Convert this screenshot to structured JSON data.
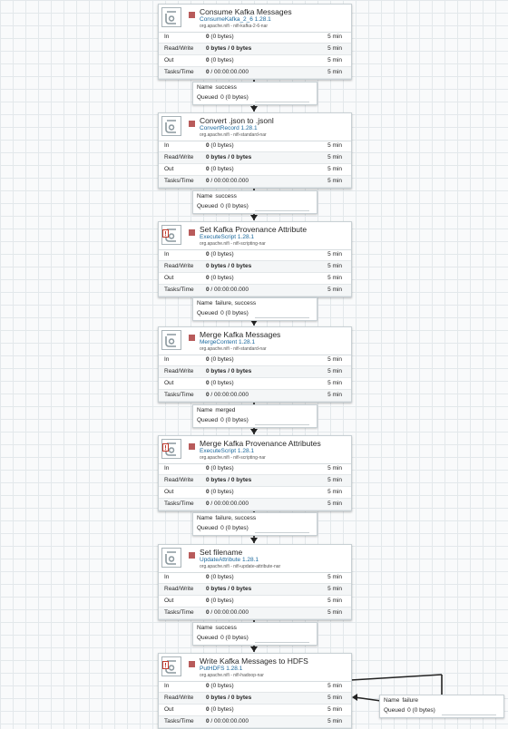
{
  "processors": [
    {
      "name": "Consume Kafka Messages",
      "type": "ConsumeKafka_2_6 1.28.1",
      "bundle": "org.apache.nifi - nifi-kafka-2-6-nar",
      "has_badge": false,
      "stats": [
        {
          "label": "In",
          "value": "0 (0 bytes)",
          "window": "5 min"
        },
        {
          "label": "Read/Write",
          "value": "0 bytes / 0 bytes",
          "window": "5 min"
        },
        {
          "label": "Out",
          "value": "0 (0 bytes)",
          "window": "5 min"
        },
        {
          "label": "Tasks/Time",
          "value": "0 / 00:00:00.000",
          "window": "5 min"
        }
      ]
    },
    {
      "name": "Convert .json to .jsonl",
      "type": "ConvertRecord 1.28.1",
      "bundle": "org.apache.nifi - nifi-standard-nar",
      "has_badge": false,
      "stats": [
        {
          "label": "In",
          "value": "0 (0 bytes)",
          "window": "5 min"
        },
        {
          "label": "Read/Write",
          "value": "0 bytes / 0 bytes",
          "window": "5 min"
        },
        {
          "label": "Out",
          "value": "0 (0 bytes)",
          "window": "5 min"
        },
        {
          "label": "Tasks/Time",
          "value": "0 / 00:00:00.000",
          "window": "5 min"
        }
      ]
    },
    {
      "name": "Set Kafka Provenance Attribute",
      "type": "ExecuteScript 1.28.1",
      "bundle": "org.apache.nifi - nifi-scripting-nar",
      "has_badge": true,
      "stats": [
        {
          "label": "In",
          "value": "0 (0 bytes)",
          "window": "5 min"
        },
        {
          "label": "Read/Write",
          "value": "0 bytes / 0 bytes",
          "window": "5 min"
        },
        {
          "label": "Out",
          "value": "0 (0 bytes)",
          "window": "5 min"
        },
        {
          "label": "Tasks/Time",
          "value": "0 / 00:00:00.000",
          "window": "5 min"
        }
      ]
    },
    {
      "name": "Merge Kafka Messages",
      "type": "MergeContent 1.28.1",
      "bundle": "org.apache.nifi - nifi-standard-nar",
      "has_badge": false,
      "stats": [
        {
          "label": "In",
          "value": "0 (0 bytes)",
          "window": "5 min"
        },
        {
          "label": "Read/Write",
          "value": "0 bytes / 0 bytes",
          "window": "5 min"
        },
        {
          "label": "Out",
          "value": "0 (0 bytes)",
          "window": "5 min"
        },
        {
          "label": "Tasks/Time",
          "value": "0 / 00:00:00.000",
          "window": "5 min"
        }
      ]
    },
    {
      "name": "Merge Kafka Provenance Attributes",
      "type": "ExecuteScript 1.28.1",
      "bundle": "org.apache.nifi - nifi-scripting-nar",
      "has_badge": true,
      "stats": [
        {
          "label": "In",
          "value": "0 (0 bytes)",
          "window": "5 min"
        },
        {
          "label": "Read/Write",
          "value": "0 bytes / 0 bytes",
          "window": "5 min"
        },
        {
          "label": "Out",
          "value": "0 (0 bytes)",
          "window": "5 min"
        },
        {
          "label": "Tasks/Time",
          "value": "0 / 00:00:00.000",
          "window": "5 min"
        }
      ]
    },
    {
      "name": "Set filename",
      "type": "UpdateAttribute 1.28.1",
      "bundle": "org.apache.nifi - nifi-update-attribute-nar",
      "has_badge": false,
      "stats": [
        {
          "label": "In",
          "value": "0 (0 bytes)",
          "window": "5 min"
        },
        {
          "label": "Read/Write",
          "value": "0 bytes / 0 bytes",
          "window": "5 min"
        },
        {
          "label": "Out",
          "value": "0 (0 bytes)",
          "window": "5 min"
        },
        {
          "label": "Tasks/Time",
          "value": "0 / 00:00:00.000",
          "window": "5 min"
        }
      ]
    },
    {
      "name": "Write Kafka Messages to HDFS",
      "type": "PutHDFS 1.28.1",
      "bundle": "org.apache.nifi - nifi-hadoop-nar",
      "has_badge": true,
      "stats": [
        {
          "label": "In",
          "value": "0 (0 bytes)",
          "window": "5 min"
        },
        {
          "label": "Read/Write",
          "value": "0 bytes / 0 bytes",
          "window": "5 min"
        },
        {
          "label": "Out",
          "value": "0 (0 bytes)",
          "window": "5 min"
        },
        {
          "label": "Tasks/Time",
          "value": "0 / 00:00:00.000",
          "window": "5 min"
        }
      ]
    }
  ],
  "connections": [
    {
      "name_label": "Name",
      "name": "success",
      "queued_label": "Queued",
      "queued": "0 (0 bytes)"
    },
    {
      "name_label": "Name",
      "name": "success",
      "queued_label": "Queued",
      "queued": "0 (0 bytes)"
    },
    {
      "name_label": "Name",
      "name": "failure, success",
      "queued_label": "Queued",
      "queued": "0 (0 bytes)"
    },
    {
      "name_label": "Name",
      "name": "merged",
      "queued_label": "Queued",
      "queued": "0 (0 bytes)"
    },
    {
      "name_label": "Name",
      "name": "failure, success",
      "queued_label": "Queued",
      "queued": "0 (0 bytes)"
    },
    {
      "name_label": "Name",
      "name": "success",
      "queued_label": "Queued",
      "queued": "0 (0 bytes)"
    },
    {
      "name_label": "Name",
      "name": "failure",
      "queued_label": "Queued",
      "queued": "0 (0 bytes)"
    }
  ],
  "colors": {
    "stopped_state": "#b85b5b",
    "processor_type_link": "#1d6a9e",
    "badge_red": "#c0392b",
    "canvas_grid": "#e3e8eb"
  }
}
